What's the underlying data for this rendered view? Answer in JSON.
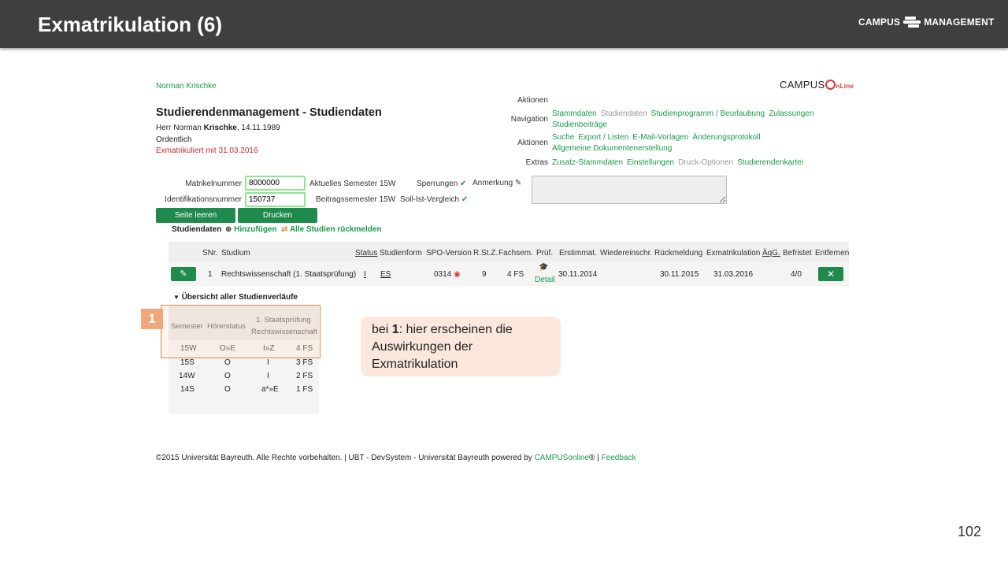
{
  "slide": {
    "title": "Exmatrikulation (6)",
    "logo": "CAMPUS MANAGEMENT",
    "logo_left": "CAMPUS",
    "logo_right": "MANAGEMENT",
    "page_number": "102"
  },
  "app": {
    "user_name": "Norman Krischke",
    "logo": {
      "campus": "CAMPUS",
      "online": "nLine"
    },
    "heading": "Studierendenmanagement - Studiendaten",
    "person": {
      "prefix": "Herr Norman ",
      "surname": "Krischke",
      "birthdate": ", 14.11.1989"
    },
    "enrollment_type": "Ordentlich",
    "status": "Exmatrikuliert mit 31.03.2016"
  },
  "nav": {
    "actions_header": "Aktionen",
    "navigation_label": "Navigation",
    "navigation_links": [
      "Stammdaten",
      "Studiendaten",
      "Studienprogramm / Beurlaubung",
      "Zulassungen",
      "Studienbeiträge"
    ],
    "actions_label": "Aktionen",
    "actions_links": [
      "Suche",
      "Export / Listen",
      "E-Mail-Vorlagen",
      "Änderungsprotokoll",
      "Allgemeine Dokumentenerstellung"
    ],
    "extras_label": "Extras",
    "extras_links": [
      "Zusatz-Stammdaten",
      "Einstellungen",
      "Druck-Optionen",
      "Studierendenkartei"
    ]
  },
  "form": {
    "matrikel_label": "Matrikelnummer",
    "matrikel_value": "8000000",
    "ident_label": "Identifikationsnummer",
    "ident_value": "150737",
    "current_semester_label": "Aktuelles Semester",
    "current_semester_value": "15W",
    "fee_semester_label": "Beitragssemester",
    "fee_semester_value": "15W",
    "blocks_label": "Sperrungen",
    "target_actual_label": "Soll-Ist-Vergleich",
    "remark_label": "Anmerkung"
  },
  "buttons": {
    "clear_page": "Seite leeren",
    "print": "Drucken"
  },
  "studies": {
    "section_title": "Studiendaten",
    "add_label": "Hinzufügen",
    "report_all_label": "Alle Studien rückmelden",
    "columns": [
      "SNr.",
      "Studium",
      "Status",
      "Studienform",
      "SPO-Version",
      "R.St.Z.",
      "Fachsem.",
      "Prüf.",
      "Erstimmat.",
      "Wiedereinschr.",
      "Rückmeldung",
      "Exmatrikulation",
      "ÄqG.",
      "Befristet",
      "Entfernen"
    ],
    "row": {
      "snr": "1",
      "studium": "Rechtswissenschaft (1. Staatsprüfung)",
      "status": "I",
      "form": "ES",
      "spo": "0314",
      "rstz": "9",
      "fachsem": "4 FS",
      "pruef": "Detail",
      "erstimmat": "30.11.2014",
      "wiedereinschr": "",
      "rueckmeldung": "30.11.2015",
      "exmatrikulation": "31.03.2016",
      "aeqg": "",
      "befristet": "4/0"
    }
  },
  "overview": {
    "title": "Übersicht aller Studienverläufe",
    "col_semester": "Semester",
    "col_hoerer": "Hörerstatus",
    "col_study_line1": "1. Staatsprüfung",
    "col_study_line2": "Rechtswissenschaft",
    "rows": [
      {
        "semester": "15W",
        "hoerer": "O»E",
        "status": "I»Z",
        "fs": "4 FS"
      },
      {
        "semester": "15S",
        "hoerer": "O",
        "status": "I",
        "fs": "3 FS"
      },
      {
        "semester": "14W",
        "hoerer": "O",
        "status": "I",
        "fs": "2 FS"
      },
      {
        "semester": "14S",
        "hoerer": "O",
        "status": "a*»E",
        "fs": "1 FS"
      }
    ]
  },
  "annotation": {
    "marker": "1",
    "callout_pre": "bei ",
    "callout_bold": "1",
    "callout_post": ": hier erscheinen die Auswirkungen der Exmatrikulation"
  },
  "footer": {
    "copyright": "©2015 Universität Bayreuth. Alle Rechte vorbehalten. | UBT - DevSystem - Universität Bayreuth powered by ",
    "product": "CAMPUSonline",
    "reg": "®",
    "separator": " | ",
    "feedback": "Feedback"
  }
}
